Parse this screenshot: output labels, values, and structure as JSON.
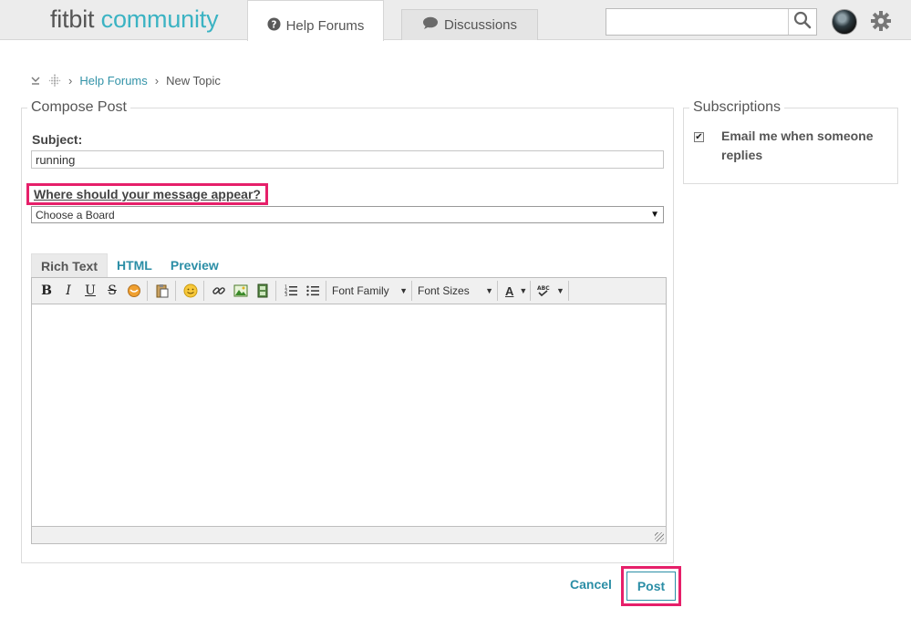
{
  "header": {
    "logo_part1": "fitbit",
    "logo_part2": "community",
    "tabs": [
      {
        "label": "Help Forums",
        "icon": "question-circle-icon",
        "active": true
      },
      {
        "label": "Discussions",
        "icon": "speech-bubble-icon",
        "active": false
      }
    ],
    "search": {
      "placeholder": "",
      "value": ""
    }
  },
  "breadcrumb": {
    "items": [
      "Help Forums",
      "New Topic"
    ]
  },
  "compose": {
    "legend": "Compose Post",
    "subject_label": "Subject:",
    "subject_value": "running",
    "where_label": "Where should your message appear?",
    "board_select_value": "Choose a Board",
    "editor_tabs": [
      "Rich Text",
      "HTML",
      "Preview"
    ],
    "toolbar": {
      "bold": "B",
      "italic": "I",
      "underline": "U",
      "strike": "S",
      "font_family": "Font Family",
      "font_sizes": "Font Sizes",
      "text_color": "A"
    }
  },
  "subscriptions": {
    "legend": "Subscriptions",
    "email_label": "Email me when someone replies",
    "checked": true
  },
  "actions": {
    "cancel": "Cancel",
    "post": "Post"
  },
  "colors": {
    "accent": "#2b8ea6",
    "highlight": "#e6206a",
    "logo_teal": "#3bb3c3"
  }
}
